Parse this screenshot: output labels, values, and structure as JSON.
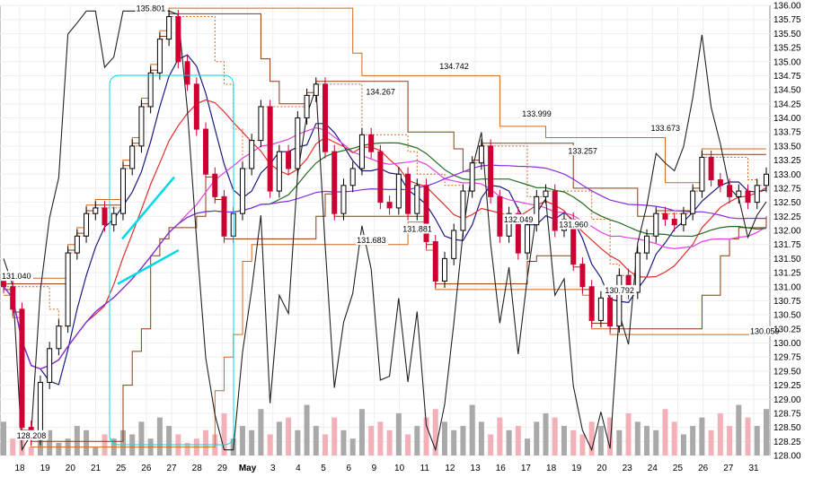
{
  "chart_data": {
    "type": "candlestick",
    "y_axis": {
      "min": 128.0,
      "max": 136.0,
      "step": 0.25,
      "position": "right"
    },
    "x_labels": [
      "18",
      "19",
      "20",
      "21",
      "25",
      "26",
      "27",
      "28",
      "29",
      "May",
      "3",
      "4",
      "5",
      "6",
      "9",
      "10",
      "11",
      "12",
      "13",
      "16",
      "17",
      "18",
      "19",
      "20",
      "23",
      "24",
      "25",
      "26",
      "27",
      "31"
    ],
    "bold_x_label": "May",
    "annotations": [
      {
        "text": "135.801",
        "x": 16,
        "y": 135.8
      },
      {
        "text": "134.742",
        "x": 49,
        "y": 134.77
      },
      {
        "text": "134.267",
        "x": 41,
        "y": 134.32
      },
      {
        "text": "133.999",
        "x": 58,
        "y": 133.93
      },
      {
        "text": "133.673",
        "x": 72,
        "y": 133.67
      },
      {
        "text": "133.257",
        "x": 63,
        "y": 133.27
      },
      {
        "text": "131.881",
        "x": 45,
        "y": 131.88
      },
      {
        "text": "132.049",
        "x": 56,
        "y": 132.05
      },
      {
        "text": "131.960",
        "x": 62,
        "y": 131.96
      },
      {
        "text": "131.683",
        "x": 40,
        "y": 131.68
      },
      {
        "text": "130.792",
        "x": 67,
        "y": 130.79
      },
      {
        "text": "130.059",
        "x": 83,
        "y": 130.06
      },
      {
        "text": "131.040",
        "x": 0,
        "y": 131.04
      },
      {
        "text": "128.208",
        "x": 3,
        "y": 128.21
      }
    ],
    "series_colors": {
      "candle_up": "#000000",
      "candle_down": "#cc0033",
      "ma_red": "#e0302a",
      "ma_navy": "#1a1a80",
      "ma_green": "#1e6b1e",
      "ma_purple": "#8a2be2",
      "ma_magenta": "#e040e0",
      "oscillator": "#222222",
      "channel_orange": "#d2691e",
      "channel_brown": "#8b3a10",
      "trend_cyan": "#00d8e8",
      "volume_up": "#a9a9a9",
      "volume_down": "#f4b0b8"
    },
    "price_path": [
      131.0,
      130.6,
      128.5,
      128.3,
      129.3,
      129.9,
      130.3,
      131.6,
      131.9,
      132.3,
      132.4,
      132.1,
      132.3,
      133.1,
      133.5,
      134.2,
      134.8,
      135.4,
      135.8,
      135.0,
      134.6,
      133.8,
      133.0,
      132.6,
      131.9,
      132.3,
      133.1,
      133.6,
      134.2,
      132.7,
      133.4,
      133.1,
      134.0,
      134.4,
      134.6,
      133.4,
      132.3,
      132.8,
      133.1,
      133.7,
      133.4,
      132.5,
      132.4,
      133.0,
      132.3,
      132.8,
      131.8,
      131.1,
      131.5,
      132.0,
      132.7,
      133.2,
      133.5,
      132.6,
      131.9,
      132.3,
      131.6,
      132.1,
      132.6,
      132.7,
      132.0,
      132.2,
      131.4,
      131.0,
      130.4,
      130.8,
      130.3,
      131.2,
      130.9,
      131.6,
      131.9,
      132.3,
      132.2,
      132.1,
      132.3,
      132.7,
      133.3,
      132.9,
      132.8,
      132.6,
      132.7,
      132.5,
      132.8,
      133.0
    ],
    "volume_max": 100,
    "volume_path": [
      40,
      20,
      30,
      10,
      25,
      30,
      15,
      20,
      35,
      30,
      10,
      25,
      20,
      30,
      25,
      40,
      20,
      45,
      35,
      25,
      15,
      20,
      30,
      25,
      50,
      20,
      35,
      30,
      55,
      25,
      40,
      45,
      30,
      60,
      35,
      25,
      45,
      30,
      20,
      55,
      35,
      40,
      30,
      50,
      25,
      35,
      45,
      55,
      40,
      30,
      35,
      60,
      40,
      25,
      45,
      30,
      35,
      20,
      40,
      50,
      45,
      35,
      30,
      25,
      40,
      35,
      45,
      30,
      50,
      40,
      35,
      30,
      55,
      40,
      25,
      35,
      45,
      30,
      50,
      35,
      60,
      45,
      35,
      55
    ]
  }
}
